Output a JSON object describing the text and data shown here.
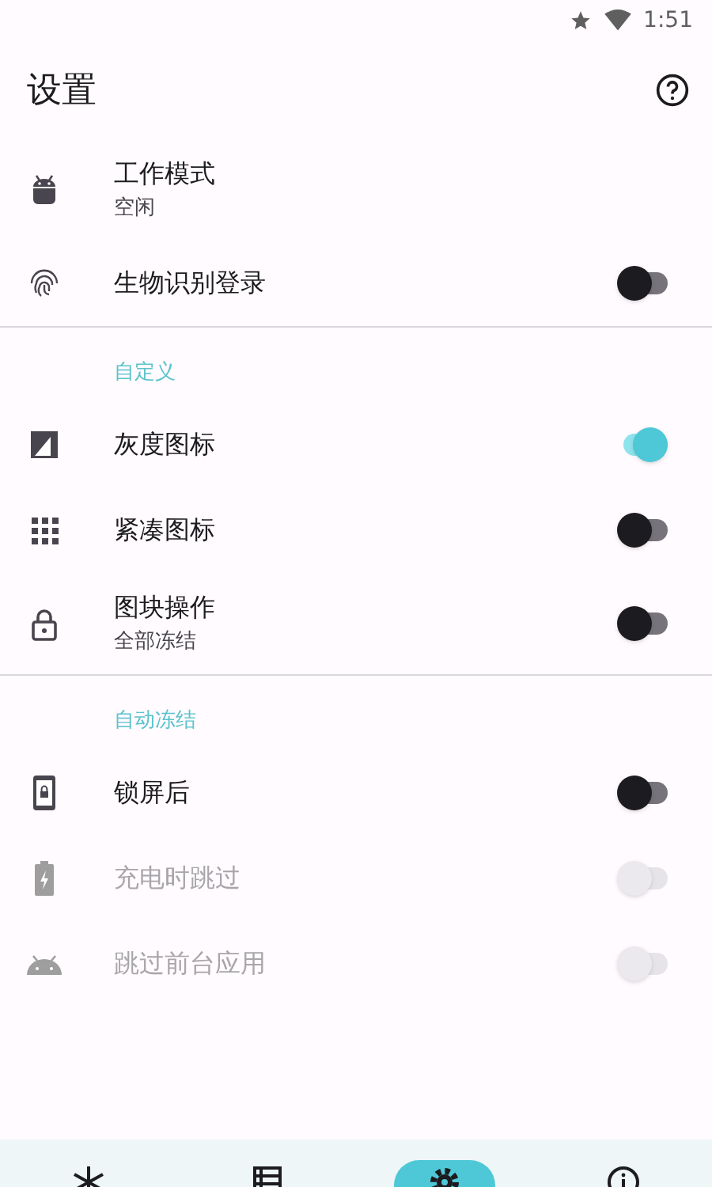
{
  "status_bar": {
    "time": "1:51"
  },
  "app_bar": {
    "title": "设置"
  },
  "sections": [
    {
      "items": [
        {
          "title": "工作模式",
          "subtitle": "空闲",
          "disabled": false
        },
        {
          "title": "生物识别登录",
          "disabled": false,
          "toggle": {
            "on": false
          }
        }
      ]
    },
    {
      "header": "自定义",
      "items": [
        {
          "title": "灰度图标",
          "disabled": false,
          "toggle": {
            "on": true
          }
        },
        {
          "title": "紧凑图标",
          "disabled": false,
          "toggle": {
            "on": false
          }
        },
        {
          "title": "图块操作",
          "subtitle": "全部冻结",
          "disabled": false,
          "toggle": {
            "on": false
          }
        }
      ]
    },
    {
      "header": "自动冻结",
      "items": [
        {
          "title": "锁屏后",
          "disabled": false,
          "toggle": {
            "on": false
          }
        },
        {
          "title": "充电时跳过",
          "disabled": true,
          "toggle": {
            "on": false
          }
        },
        {
          "title": "跳过前台应用",
          "disabled": true,
          "toggle": {
            "on": false
          }
        }
      ]
    }
  ],
  "bottom_nav": [
    {
      "selected": false
    },
    {
      "selected": false
    },
    {
      "selected": true
    },
    {
      "selected": false
    }
  ]
}
